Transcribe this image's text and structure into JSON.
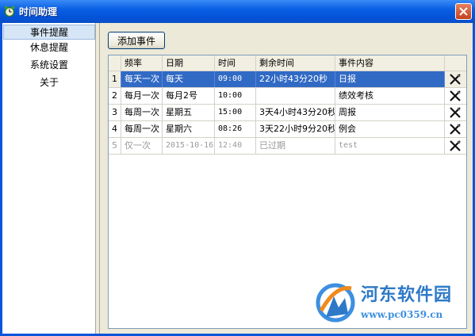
{
  "window": {
    "title": "时间助理"
  },
  "sidebar": {
    "items": [
      {
        "label": "事件提醒",
        "active": true
      },
      {
        "label": "休息提醒",
        "active": false
      },
      {
        "label": "系统设置",
        "active": false
      },
      {
        "label": "关于",
        "active": false
      }
    ]
  },
  "toolbar": {
    "add_label": "添加事件"
  },
  "table": {
    "columns": [
      "",
      "频率",
      "日期",
      "时间",
      "剩余时间",
      "事件内容",
      ""
    ],
    "rows": [
      {
        "index": "1",
        "frequency": "每天一次",
        "date": "每天",
        "time": "09:00",
        "remaining": "22小时43分20秒",
        "content": "日报",
        "selected": true,
        "expired": false
      },
      {
        "index": "2",
        "frequency": "每月一次",
        "date": "每月2号",
        "time": "10:00",
        "remaining": "",
        "content": "绩效考核",
        "selected": false,
        "expired": false
      },
      {
        "index": "3",
        "frequency": "每周一次",
        "date": "星期五",
        "time": "15:00",
        "remaining": "3天4小时43分20秒",
        "content": "周报",
        "selected": false,
        "expired": false
      },
      {
        "index": "4",
        "frequency": "每周一次",
        "date": "星期六",
        "time": "08:26",
        "remaining": "3天22小时9分20秒",
        "content": "例会",
        "selected": false,
        "expired": false
      },
      {
        "index": "5",
        "frequency": "仅一次",
        "date": "2015-10-16",
        "time": "12:40",
        "remaining": "已过期",
        "content": "test",
        "selected": false,
        "expired": true
      }
    ]
  },
  "watermark": {
    "name": "河东软件园",
    "url": "www.pc0359.cn"
  },
  "colors": {
    "titlebar": "#0a5fe3",
    "selection": "#316ac5",
    "sidebar_active": "#d6e6f7",
    "watermark": "#2d79c7"
  }
}
